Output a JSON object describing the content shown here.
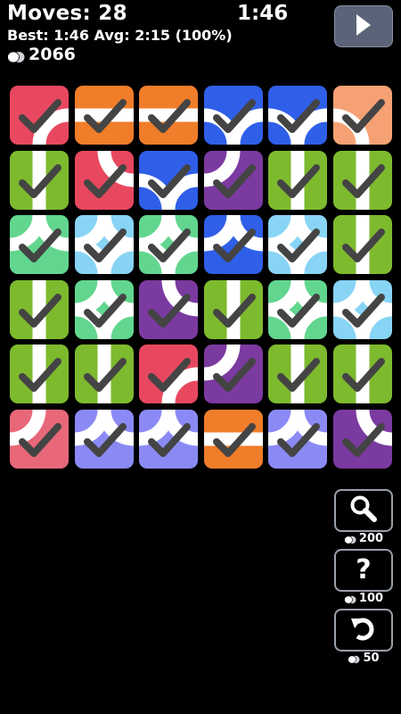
{
  "hud": {
    "moves": "Moves: 28",
    "timer": "1:46",
    "best": "Best: 1:46 Avg: 2:15 (100%)",
    "coins": "2066",
    "coin_icon": "coin-stack-icon",
    "play_icon": "play-icon"
  },
  "colors": {
    "red": "#e8485f",
    "orange": "#f07d29",
    "blue": "#2f5fe8",
    "peach": "#f5a173",
    "green": "#7dba2e",
    "purple": "#7b3aa0",
    "mint": "#62d68f",
    "sky": "#88d4f5",
    "pink": "#e8687a",
    "lavender": "#8b8af5",
    "check": "#444444",
    "path": "#ffffff"
  },
  "board": {
    "rows": [
      [
        {
          "color": "red",
          "path": "arc-br"
        },
        {
          "color": "orange",
          "path": "straight-h"
        },
        {
          "color": "orange",
          "path": "straight-h"
        },
        {
          "color": "blue",
          "path": "arc-bl-br"
        },
        {
          "color": "blue",
          "path": "arc-bl-br"
        },
        {
          "color": "peach",
          "path": "arc-bl"
        }
      ],
      [
        {
          "color": "green",
          "path": "straight-v"
        },
        {
          "color": "red",
          "path": "arc-tr"
        },
        {
          "color": "blue",
          "path": "arc-bl-br"
        },
        {
          "color": "purple",
          "path": "arc-tl"
        },
        {
          "color": "green",
          "path": "straight-v"
        },
        {
          "color": "green",
          "path": "straight-v"
        }
      ],
      [
        {
          "color": "mint",
          "path": "arc-tl-tr"
        },
        {
          "color": "sky",
          "path": "arc-all"
        },
        {
          "color": "mint",
          "path": "arc-all"
        },
        {
          "color": "blue",
          "path": "arc-tl-tr"
        },
        {
          "color": "sky",
          "path": "arc-all"
        },
        {
          "color": "green",
          "path": "straight-v"
        }
      ],
      [
        {
          "color": "green",
          "path": "straight-v"
        },
        {
          "color": "mint",
          "path": "arc-all"
        },
        {
          "color": "purple",
          "path": "arc-tr"
        },
        {
          "color": "green",
          "path": "straight-v"
        },
        {
          "color": "mint",
          "path": "arc-all"
        },
        {
          "color": "sky",
          "path": "arc-all"
        }
      ],
      [
        {
          "color": "green",
          "path": "straight-v"
        },
        {
          "color": "green",
          "path": "straight-v"
        },
        {
          "color": "red",
          "path": "arc-br"
        },
        {
          "color": "purple",
          "path": "arc-tl"
        },
        {
          "color": "green",
          "path": "straight-v"
        },
        {
          "color": "green",
          "path": "straight-v"
        }
      ],
      [
        {
          "color": "pink",
          "path": "arc-tl"
        },
        {
          "color": "lavender",
          "path": "arc-tl-tr"
        },
        {
          "color": "lavender",
          "path": "arc-tl-tr"
        },
        {
          "color": "orange",
          "path": "straight-h"
        },
        {
          "color": "lavender",
          "path": "arc-tl-tr"
        },
        {
          "color": "purple",
          "path": "arc-tr"
        }
      ]
    ]
  },
  "tools": [
    {
      "name": "hint-button",
      "icon": "magnifier-icon",
      "cost": "200"
    },
    {
      "name": "help-button",
      "icon": "question-mark-icon",
      "cost": "100"
    },
    {
      "name": "undo-button",
      "icon": "undo-icon",
      "cost": "50"
    }
  ]
}
